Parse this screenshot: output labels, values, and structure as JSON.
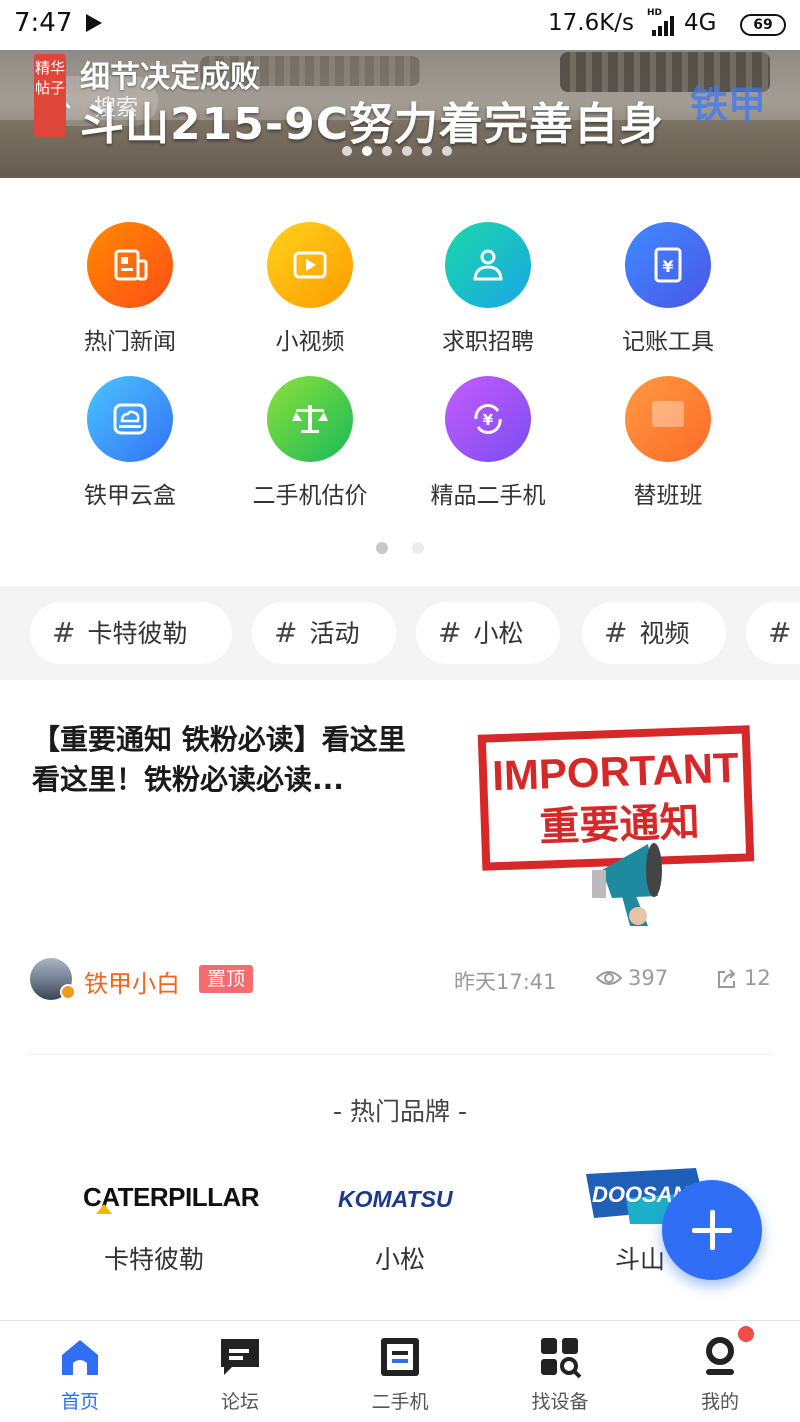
{
  "status_bar": {
    "time": "7:47",
    "net_speed": "17.6K/s",
    "hd": "HD",
    "network": "4G",
    "battery": "69"
  },
  "banner": {
    "tag": "精华帖子",
    "subtitle": "细节决定成败",
    "title": "斗山215-9C努力着完善自身",
    "search_placeholder": "搜索",
    "brand_mark": "铁甲",
    "slide_count": 6,
    "active_slide": 1
  },
  "quick_menu": {
    "pages": 2,
    "active_page": 0,
    "items": [
      {
        "label": "热门新闻",
        "icon": "news-icon",
        "colors": [
          "#ff8a00",
          "#ff4d16"
        ]
      },
      {
        "label": "小视频",
        "icon": "video-icon",
        "colors": [
          "#ffd21a",
          "#ff9a00"
        ]
      },
      {
        "label": "求职招聘",
        "icon": "person-icon",
        "colors": [
          "#19d8a8",
          "#1aa6e6"
        ]
      },
      {
        "label": "记账工具",
        "icon": "ledger-icon",
        "colors": [
          "#3f8cff",
          "#4a55e8"
        ]
      },
      {
        "label": "铁甲云盒",
        "icon": "cloud-box-icon",
        "colors": [
          "#49c6ff",
          "#3470f5"
        ]
      },
      {
        "label": "二手机估价",
        "icon": "scale-icon",
        "colors": [
          "#8ee23a",
          "#19b85a"
        ]
      },
      {
        "label": "精品二手机",
        "icon": "yuan-exchange-icon",
        "colors": [
          "#c65cff",
          "#7a4cf0"
        ]
      },
      {
        "label": "替班班",
        "icon": "substitute-icon",
        "colors": [
          "#ff9a40",
          "#ff6a2a"
        ]
      }
    ]
  },
  "topic_tags": [
    {
      "hash": "#",
      "label": "卡特彼勒"
    },
    {
      "hash": "#",
      "label": "活动"
    },
    {
      "hash": "#",
      "label": "小松"
    },
    {
      "hash": "#",
      "label": "视频"
    },
    {
      "hash": "#",
      "label": ""
    }
  ],
  "article": {
    "title": "【重要通知 铁粉必读】看这里看这里！铁粉必读必读...",
    "image_text_en": "IMPORTANT",
    "image_text_cn": "重要通知",
    "author": "铁甲小白",
    "pin_label": "置顶",
    "time": "昨天17:41",
    "views": "397",
    "shares": "12"
  },
  "brands": {
    "title": "- 热门品牌 -",
    "items": [
      {
        "name": "卡特彼勒",
        "logo_text": "CATERPILLAR"
      },
      {
        "name": "小松",
        "logo_text": "KOMATSU"
      },
      {
        "name": "斗山",
        "logo_text": "DOOSAN"
      }
    ]
  },
  "bottom_nav": {
    "active": 0,
    "items": [
      {
        "label": "首页",
        "icon": "home-icon"
      },
      {
        "label": "论坛",
        "icon": "chat-icon"
      },
      {
        "label": "二手机",
        "icon": "used-machine-icon"
      },
      {
        "label": "找设备",
        "icon": "find-device-icon"
      },
      {
        "label": "我的",
        "icon": "profile-icon"
      }
    ]
  },
  "colors": {
    "accent": "#2f6ef5",
    "author": "#f0661c",
    "pin": "#f46b70",
    "notification_dot": "#f44b47"
  }
}
